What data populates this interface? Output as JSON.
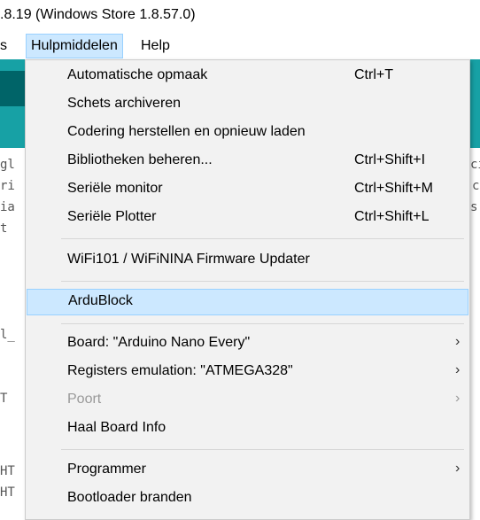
{
  "window": {
    "title": ".8.19 (Windows Store 1.8.57.0)"
  },
  "menubar": {
    "cut_label": "s",
    "hulpmiddelen": "Hulpmiddelen",
    "help": "Help"
  },
  "editor": {
    "left_fragments": [
      "gl",
      "ri",
      "ia",
      "t",
      "l_",
      "T",
      "HT",
      "HT"
    ],
    "right_fragments": [
      "ci",
      "c",
      "s"
    ]
  },
  "menu": {
    "items": [
      {
        "label": "Automatische opmaak",
        "shortcut": "Ctrl+T"
      },
      {
        "label": "Schets archiveren",
        "shortcut": ""
      },
      {
        "label": "Codering herstellen en opnieuw laden",
        "shortcut": ""
      },
      {
        "label": "Bibliotheken beheren...",
        "shortcut": "Ctrl+Shift+I"
      },
      {
        "label": "Seriële monitor",
        "shortcut": "Ctrl+Shift+M"
      },
      {
        "label": "Seriële Plotter",
        "shortcut": "Ctrl+Shift+L"
      },
      {
        "label": "WiFi101 / WiFiNINA Firmware Updater",
        "shortcut": ""
      },
      {
        "label": "ArduBlock",
        "shortcut": "",
        "highlighted": true
      },
      {
        "label": "Board: \"Arduino Nano Every\"",
        "submenu": true
      },
      {
        "label": "Registers emulation: \"ATMEGA328\"",
        "submenu": true
      },
      {
        "label": "Poort",
        "submenu": true,
        "disabled": true
      },
      {
        "label": "Haal Board Info"
      },
      {
        "label": "Programmer",
        "submenu": true
      },
      {
        "label": "Bootloader branden"
      }
    ],
    "arrow_glyph": "›"
  },
  "colors": {
    "highlight": "#cce8ff",
    "teal": "#17a1a5",
    "menu_bg": "#f2f2f2"
  }
}
